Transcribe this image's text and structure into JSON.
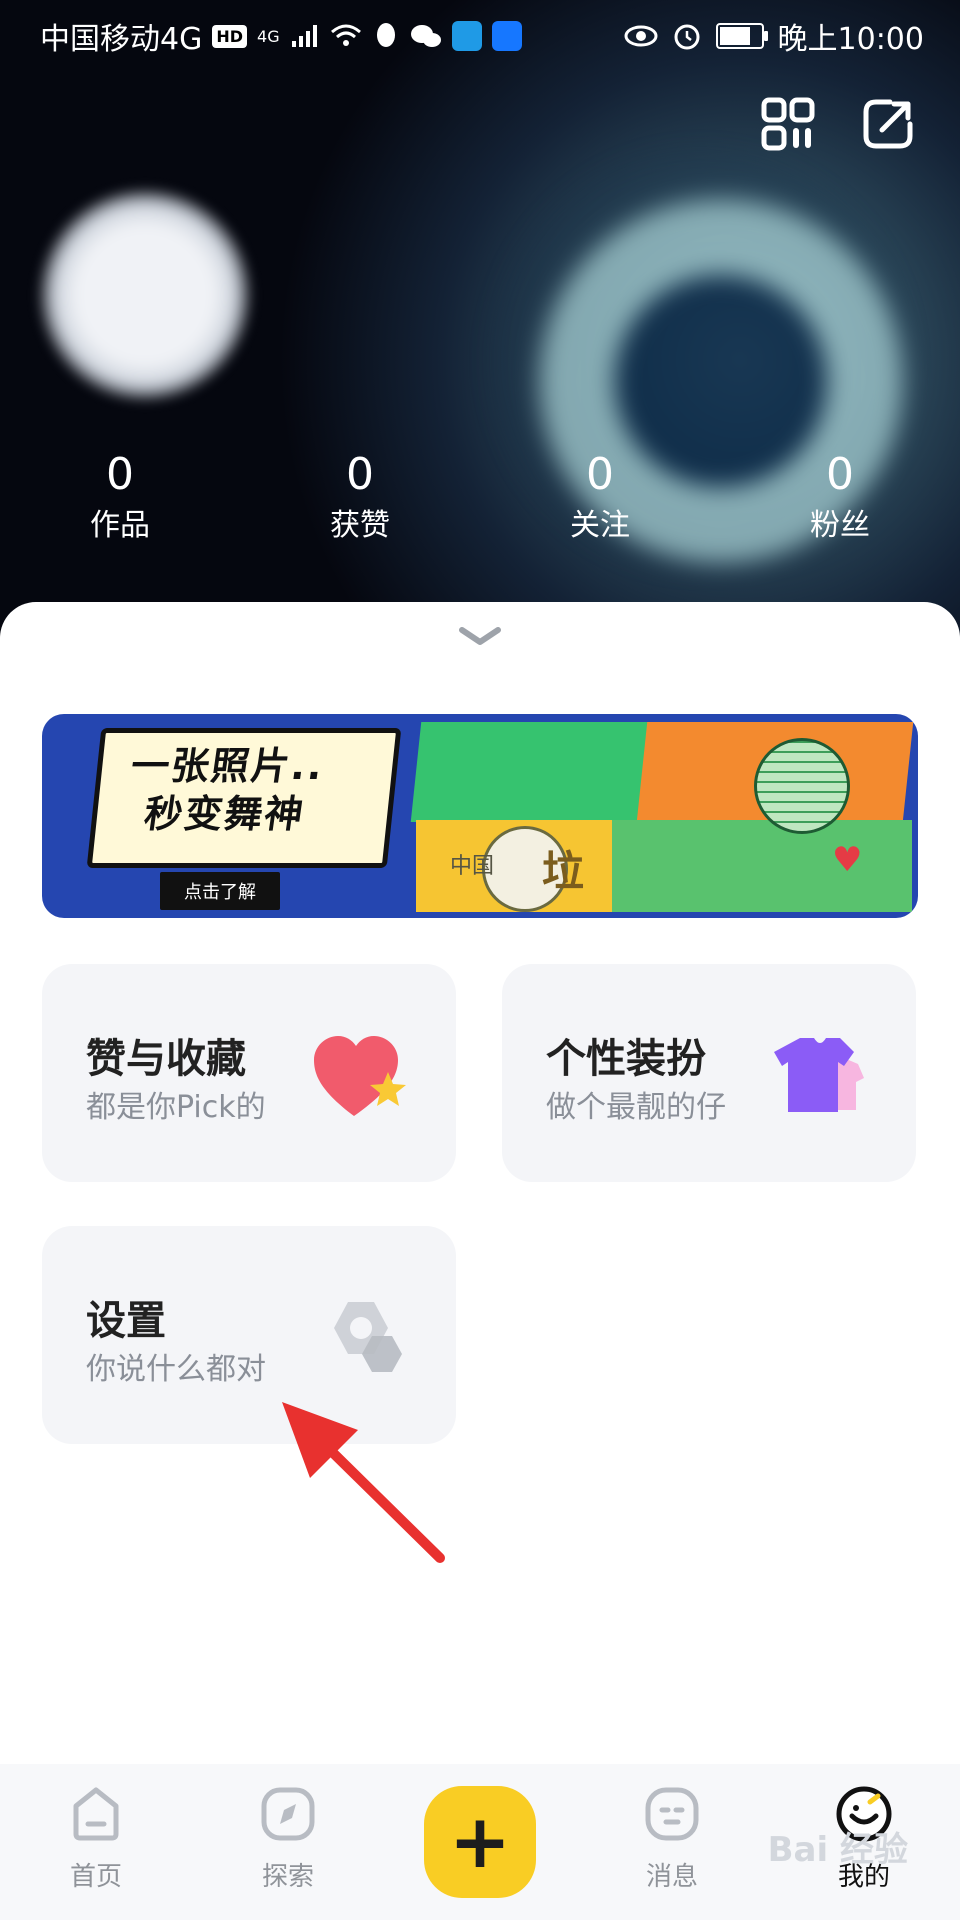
{
  "status_bar": {
    "carrier": "中国移动4G",
    "hd_badge": "HD",
    "network": "4G",
    "time": "晚上10:00"
  },
  "header": {
    "stats": [
      {
        "value": "0",
        "label": "作品"
      },
      {
        "value": "0",
        "label": "获赞"
      },
      {
        "value": "0",
        "label": "关注"
      },
      {
        "value": "0",
        "label": "粉丝"
      }
    ]
  },
  "banner": {
    "title_line1": "一张照片..",
    "title_line2": "秒变舞神",
    "button_label": "点击了解",
    "small_text": "中国",
    "big_char": "垃"
  },
  "cards": [
    {
      "title": "赞与收藏",
      "subtitle": "都是你Pick的",
      "icon": "heart-star-icon"
    },
    {
      "title": "个性装扮",
      "subtitle": "做个最靓的仔",
      "icon": "tshirt-icon"
    },
    {
      "title": "设置",
      "subtitle": "你说什么都对",
      "icon": "hexagon-icon"
    }
  ],
  "bottom_nav": [
    {
      "label": "首页",
      "icon": "home-icon"
    },
    {
      "label": "探索",
      "icon": "compass-icon"
    },
    {
      "label": "",
      "icon": "plus-icon"
    },
    {
      "label": "消息",
      "icon": "message-icon"
    },
    {
      "label": "我的",
      "icon": "profile-face-icon",
      "active": true
    }
  ],
  "watermark": "Bai 经验",
  "colors": {
    "accent_yellow": "#f9cd24",
    "banner_blue": "#2546b0",
    "card_bg": "#f4f5f8",
    "arrow_red": "#e8312f"
  }
}
